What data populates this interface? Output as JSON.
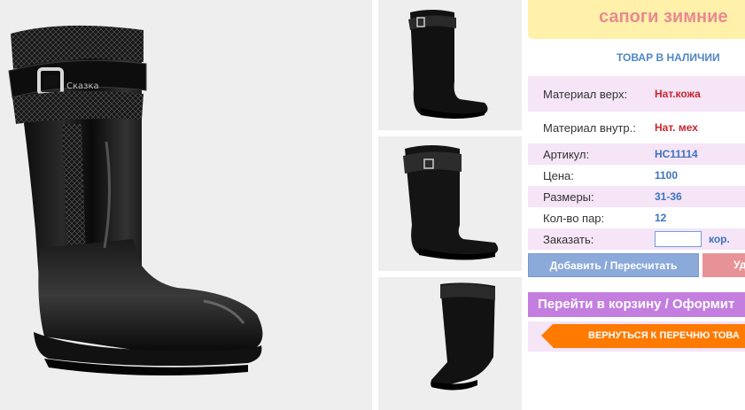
{
  "product": {
    "title": "сапоги зимние",
    "stock_status": "ТОВАР В НАЛИЧИИ"
  },
  "specs": {
    "upper_label": "Материал верх:",
    "upper_value": "Нат.кожа",
    "inner_label": "Материал внутр.:",
    "inner_value": "Нат. мех",
    "sku_label": "Артикул:",
    "sku_value": "НС11114",
    "price_label": "Цена:",
    "price_value": "1100",
    "sizes_label": "Размеры:",
    "sizes_value": "31-36",
    "pairs_label": "Кол-во пар:",
    "pairs_value": "12",
    "order_label": "Заказать:",
    "order_value": "",
    "order_unit": "кор."
  },
  "buttons": {
    "add_label": "Добавить / Пересчитать",
    "delete_label": "Уд",
    "cart_label": "Перейти в корзину / Оформит",
    "back_label": "ВЕРНУТЬСЯ К ПЕРЕЧНЮ ТОВА"
  },
  "brand_mark": "Сказка",
  "colors": {
    "title_bg": "#fff0aa",
    "title_text": "#e98a8f",
    "accent_blue": "#3c74c0",
    "value_red": "#c8262e",
    "row_pink": "#f6e4f7",
    "add_button": "#8caad9",
    "delete_button": "#e79297",
    "cart_button": "#c47ee0",
    "back_button": "#ff7a00"
  }
}
